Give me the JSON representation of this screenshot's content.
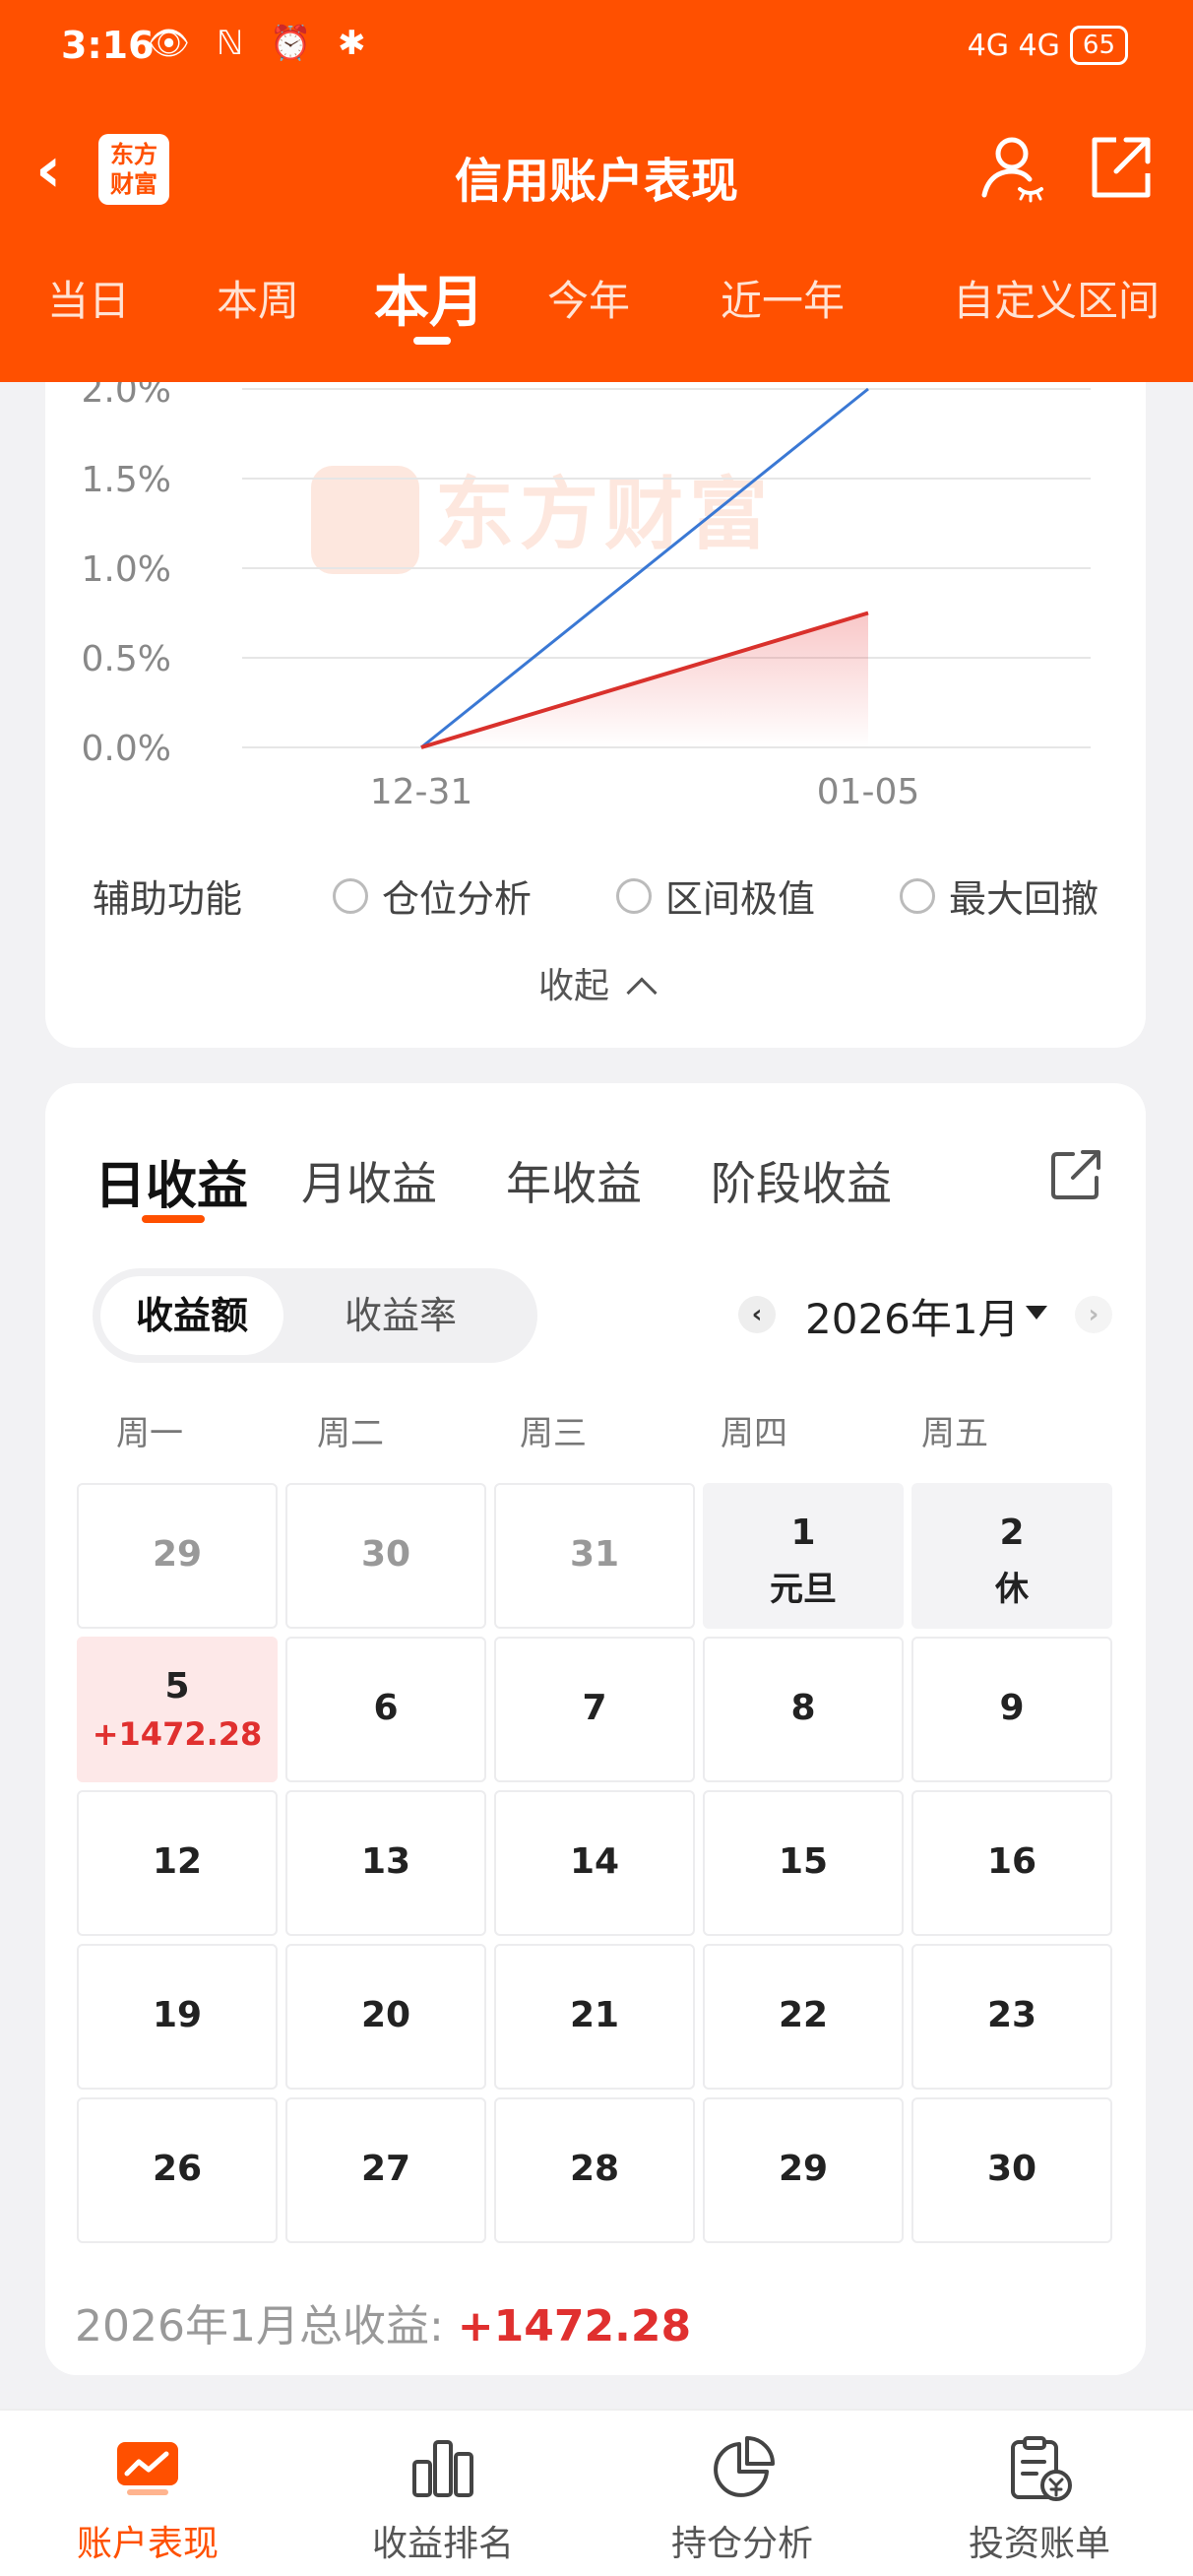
{
  "status_bar": {
    "time": "3:16",
    "left_icons": "👁 ℕ ⏰ ✱",
    "network": "4G 4G",
    "battery": "65"
  },
  "header": {
    "title": "信用账户表现",
    "logo_line1": "东方",
    "logo_line2": "财富",
    "back_glyph": "‹"
  },
  "period_tabs": [
    {
      "label": "当日"
    },
    {
      "label": "本周"
    },
    {
      "label": "本月"
    },
    {
      "label": "今年"
    },
    {
      "label": "近一年"
    },
    {
      "label": "自定义区间"
    }
  ],
  "active_period": "本月",
  "chart_data": {
    "type": "line",
    "x": [
      "12-31",
      "01-05"
    ],
    "y_ticks": [
      "2.0%",
      "1.5%",
      "1.0%",
      "0.5%",
      "0.0%"
    ],
    "ylim": [
      0,
      2.0
    ],
    "y_unit": "%",
    "grid": true,
    "watermark": "东方财富",
    "series": [
      {
        "color": "#3a78d4",
        "values": [
          0.0,
          2.0
        ]
      },
      {
        "color": "#d9312c",
        "values": [
          0.0,
          0.75
        ],
        "fill": true
      }
    ]
  },
  "aux": {
    "label": "辅助功能",
    "options": [
      "仓位分析",
      "区间极值",
      "最大回撤"
    ]
  },
  "collapse_label": "收起",
  "earnings_tabs": [
    {
      "label": "日收益"
    },
    {
      "label": "月收益"
    },
    {
      "label": "年收益"
    },
    {
      "label": "阶段收益"
    }
  ],
  "segment": {
    "active": "收益额",
    "other": "收益率"
  },
  "month_nav": {
    "prev": "‹",
    "label": "2026年1月",
    "next": "›"
  },
  "weekdays": [
    "周一",
    "周二",
    "周三",
    "周四",
    "周五"
  ],
  "calendar": [
    [
      {
        "day": "29",
        "muted": true
      },
      {
        "day": "30",
        "muted": true
      },
      {
        "day": "31",
        "muted": true
      },
      {
        "day": "1",
        "sub": "元旦",
        "holiday": true
      },
      {
        "day": "2",
        "sub": "休",
        "holiday": true
      }
    ],
    [
      {
        "day": "5",
        "sub": "+1472.28",
        "gain": true
      },
      {
        "day": "6"
      },
      {
        "day": "7"
      },
      {
        "day": "8"
      },
      {
        "day": "9"
      }
    ],
    [
      {
        "day": "12"
      },
      {
        "day": "13"
      },
      {
        "day": "14"
      },
      {
        "day": "15"
      },
      {
        "day": "16"
      }
    ],
    [
      {
        "day": "19"
      },
      {
        "day": "20"
      },
      {
        "day": "21"
      },
      {
        "day": "22"
      },
      {
        "day": "23"
      }
    ],
    [
      {
        "day": "26"
      },
      {
        "day": "27"
      },
      {
        "day": "28"
      },
      {
        "day": "29"
      },
      {
        "day": "30"
      }
    ]
  ],
  "total": {
    "label": "2026年1月总收益:",
    "value": "+1472.28"
  },
  "bottom_nav": [
    {
      "label": "账户表现",
      "icon": "chart-screen-icon",
      "active": true
    },
    {
      "label": "收益排名",
      "icon": "bar-chart-icon"
    },
    {
      "label": "持仓分析",
      "icon": "pie-chart-icon"
    },
    {
      "label": "投资账单",
      "icon": "bill-icon"
    }
  ],
  "colors": {
    "brand": "#ff5000",
    "gain": "#e0302f",
    "line_blue": "#3a78d4"
  }
}
